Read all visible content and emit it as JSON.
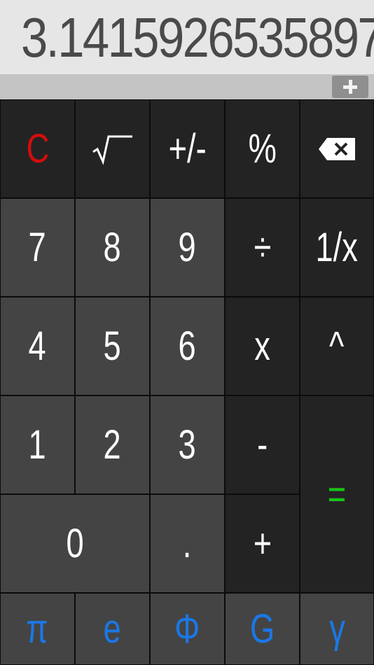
{
  "display": {
    "value": "3.1415926535897"
  },
  "toolbar": {
    "add_icon": "plus-icon"
  },
  "keys": {
    "clear": "C",
    "sqrt": "sqrt-icon",
    "sign": "+/-",
    "percent": "%",
    "backspace": "backspace-icon",
    "seven": "7",
    "eight": "8",
    "nine": "9",
    "divide": "÷",
    "reciprocal": "1/x",
    "four": "4",
    "five": "5",
    "six": "6",
    "multiply": "x",
    "power": "^",
    "one": "1",
    "two": "2",
    "three": "3",
    "minus": "-",
    "equals": "=",
    "zero": "0",
    "decimal": ".",
    "plus": "+",
    "pi": "π",
    "euler": "e",
    "phi": "Φ",
    "gravity": "G",
    "gamma": "γ"
  },
  "colors": {
    "display_bg": "#e6e6e6",
    "display_text": "#4a4a4a",
    "strip_bg": "#c4c4c4",
    "dark_key": "#232323",
    "number_key": "#444444",
    "clear_text": "#d40d0d",
    "equals_text": "#17c317",
    "constant_text": "#1a78e6"
  }
}
